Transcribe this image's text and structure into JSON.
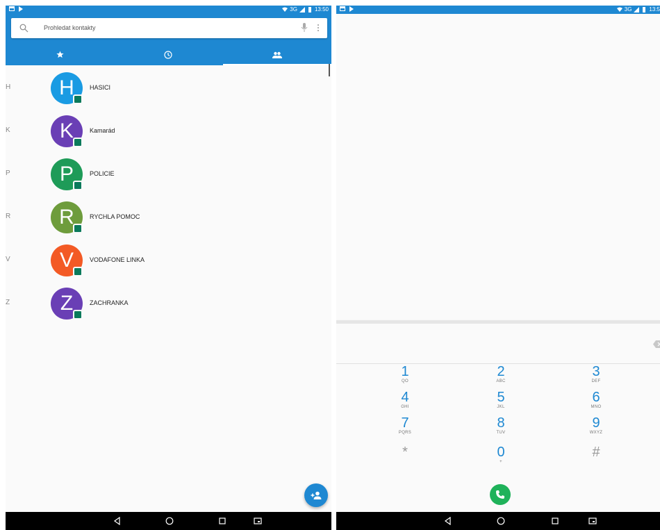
{
  "left": {
    "status": {
      "network": "3G",
      "time": "13:50"
    },
    "search": {
      "placeholder": "Prohledat kontakty"
    },
    "tabs": [
      {
        "name": "favorites",
        "icon": "star-icon",
        "active": false
      },
      {
        "name": "recents",
        "icon": "clock-icon",
        "active": false
      },
      {
        "name": "contacts",
        "icon": "people-icon",
        "active": true
      }
    ],
    "contacts": [
      {
        "letter": "H",
        "initial": "H",
        "name": "HASICI",
        "color": "#1a9be3"
      },
      {
        "letter": "K",
        "initial": "K",
        "name": "Kamarád",
        "color": "#6a3fb5"
      },
      {
        "letter": "P",
        "initial": "P",
        "name": "POLICIE",
        "color": "#1e9b58"
      },
      {
        "letter": "R",
        "initial": "R",
        "name": "RYCHLA POMOC",
        "color": "#6e9c3c"
      },
      {
        "letter": "V",
        "initial": "V",
        "name": "VODAFONE LINKA",
        "color": "#f35a25"
      },
      {
        "letter": "Z",
        "initial": "Z",
        "name": "ZACHRANKA",
        "color": "#6a3fb5"
      }
    ]
  },
  "right": {
    "status": {
      "network": "3G",
      "time": "13:5"
    },
    "keys": [
      {
        "num": "1",
        "sub": "QO"
      },
      {
        "num": "2",
        "sub": "ABC"
      },
      {
        "num": "3",
        "sub": "DEF"
      },
      {
        "num": "4",
        "sub": "GHI"
      },
      {
        "num": "5",
        "sub": "JKL"
      },
      {
        "num": "6",
        "sub": "MNO"
      },
      {
        "num": "7",
        "sub": "PQRS"
      },
      {
        "num": "8",
        "sub": "TUV"
      },
      {
        "num": "9",
        "sub": "WXYZ"
      },
      {
        "num": "*",
        "sub": ""
      },
      {
        "num": "0",
        "sub": "+"
      },
      {
        "num": "#",
        "sub": ""
      }
    ]
  },
  "colors": {
    "accent": "#1e88d2",
    "call": "#1fb25a",
    "badge": "#0b7a5b"
  }
}
